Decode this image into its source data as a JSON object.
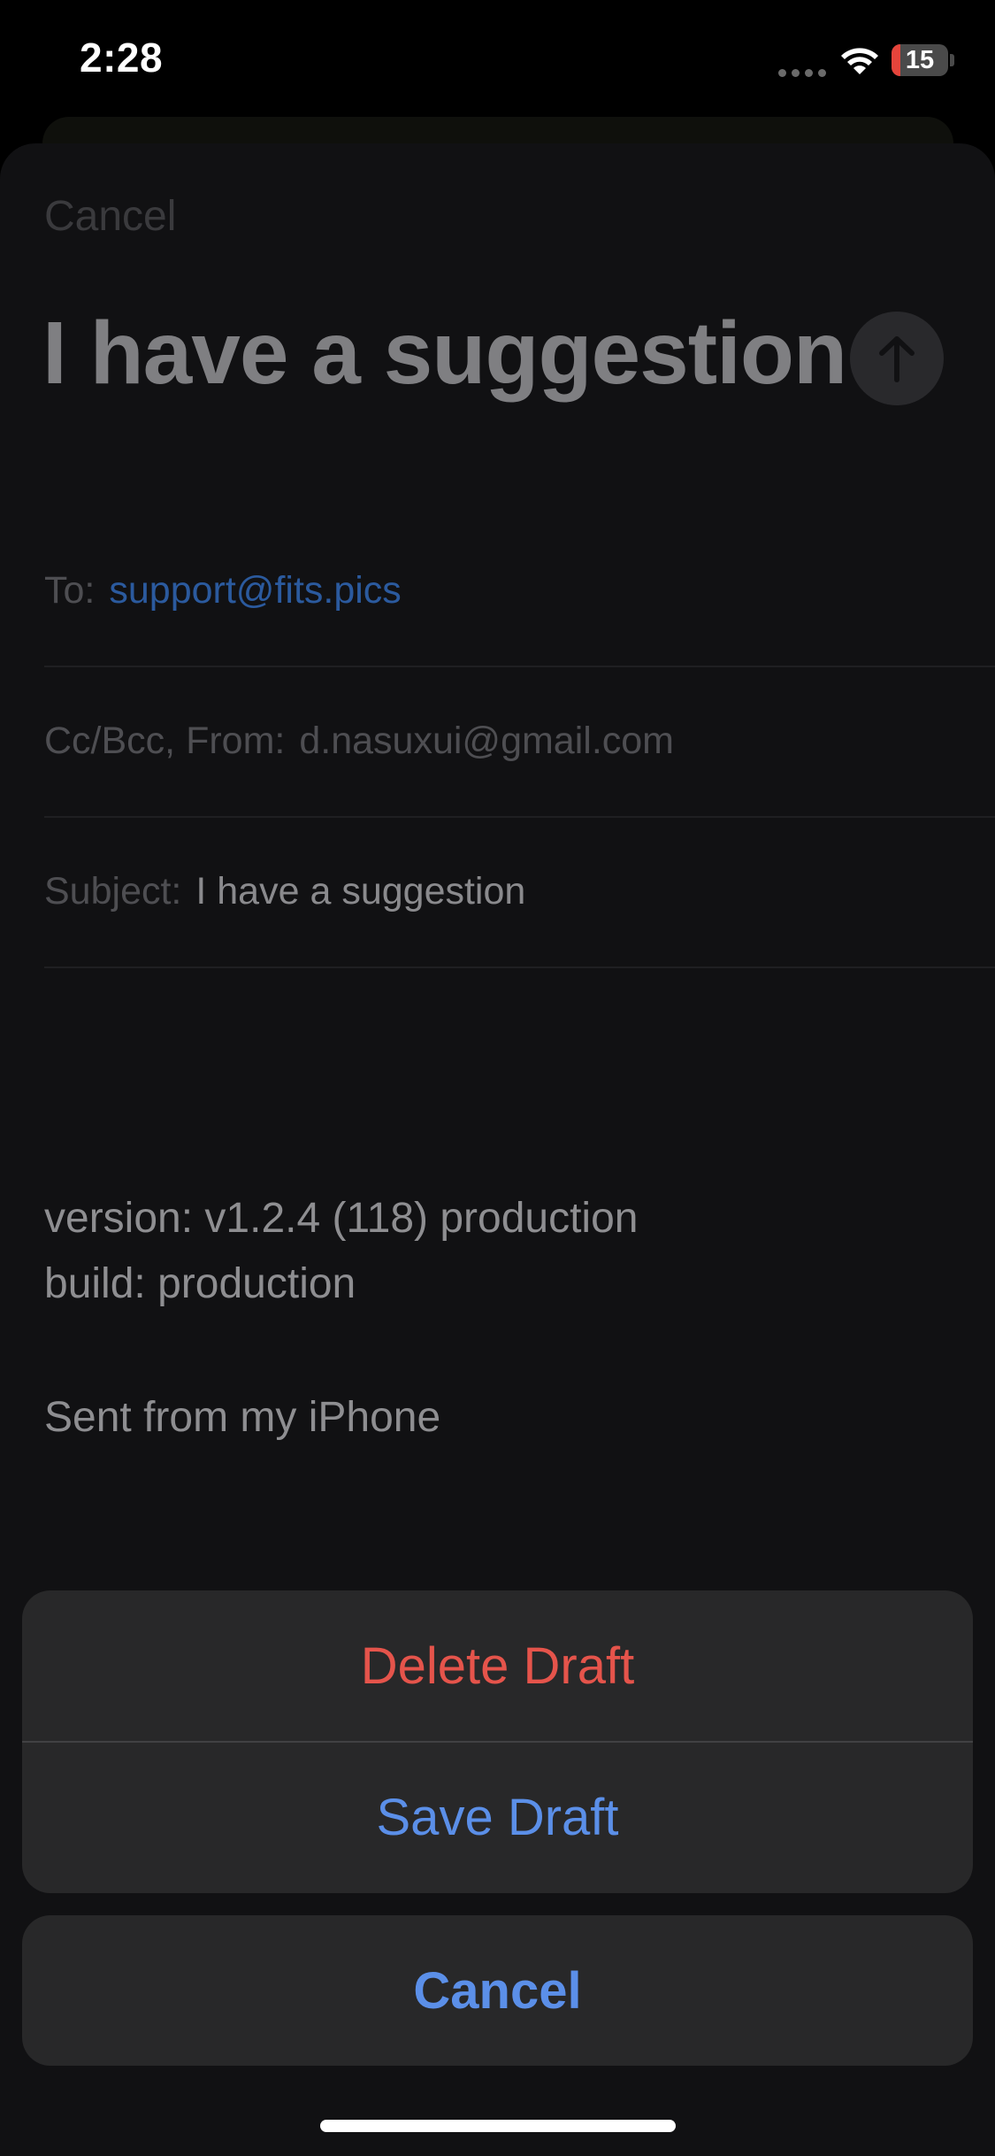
{
  "status_bar": {
    "time": "2:28",
    "battery_level": "15",
    "battery_fraction": 0.15,
    "wifi_icon": "wifi-icon",
    "signal_icon": "cellular-dots-icon"
  },
  "compose": {
    "cancel_label": "Cancel",
    "title": "I have a suggestion",
    "send_icon": "arrow-up-icon",
    "to_label": "To:",
    "to_value": "support@fits.pics",
    "ccbcc_label": "Cc/Bcc, From:",
    "from_value": "d.nasuxui@gmail.com",
    "subject_label": "Subject:",
    "subject_value": "I have a suggestion",
    "body_lines": [
      "version: v1.2.4 (118) production",
      "build: production"
    ],
    "signature": "Sent from my iPhone"
  },
  "action_sheet": {
    "delete_label": "Delete Draft",
    "save_label": "Save Draft",
    "cancel_label": "Cancel"
  },
  "colors": {
    "destructive": "#e5544b",
    "accent": "#5b8fe8",
    "link": "#2b5a9e"
  }
}
